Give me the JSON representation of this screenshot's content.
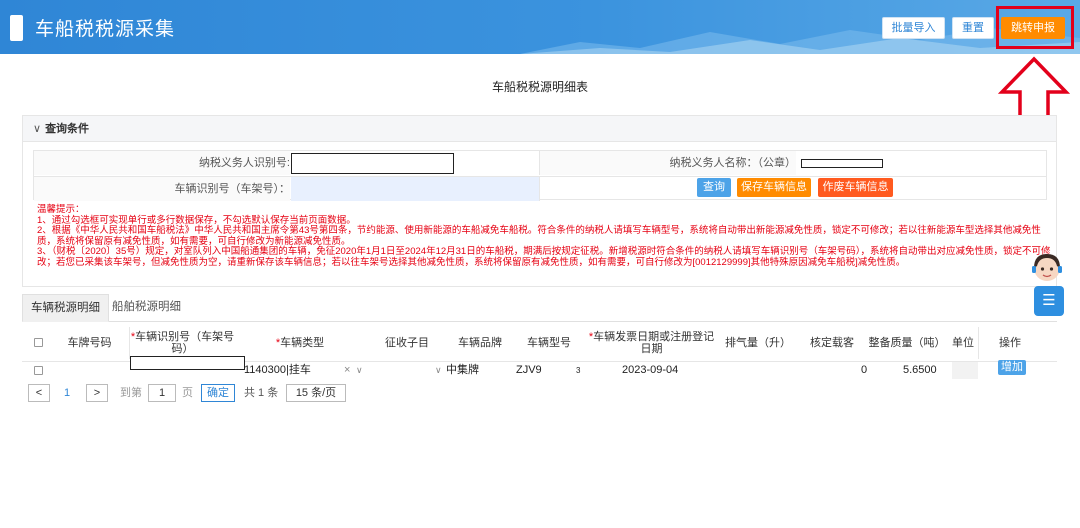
{
  "header": {
    "title": "车船税税源采集",
    "buttons": {
      "import": "批量导入",
      "reset": "重置",
      "jump": "跳转申报"
    }
  },
  "table_title": "车船税税源明细表",
  "query": {
    "heading": "查询条件",
    "taxpayer_id_label": "纳税义务人识别号:",
    "taxpayer_id_value": "",
    "taxpayer_name_label": "纳税义务人名称：（公章）",
    "taxpayer_name_value": "",
    "vehicle_id_label": "车辆识别号（车架号）：",
    "vehicle_id_value": "",
    "buttons": {
      "search": "查询",
      "save": "保存车辆信息",
      "void": "作废车辆信息"
    }
  },
  "tips": {
    "title": "温馨提示：",
    "line1": "1、通过勾选框可实现单行或多行数据保存，不勾选默认保存当前页面数据。",
    "line2": "2、根据《中华人民共和国车船税法》中华人民共和国主席令第43号第四条，节约能源、使用新能源的车船减免车船税。符合条件的纳税人请填写车辆型号，系统将自动带出新能源减免性质，锁定不可修改；若以往新能源车型选择其他减免性质，系统将保留原有减免性质，如有需要，可自行修改为新能源减免性质。",
    "line3": "3、（财税〔2020〕35号）规定，对室队列入中国船通集团的车辆，免征2020年1月1日至2024年12月31日的车船税，期满后按规定征税。新增税源时符合条件的纳税人请填写车辆识别号（车架号码），系统将自动带出对应减免性质，锁定不可修改；若您已采集该车架号，但减免性质为空，请重新保存该车辆信息；若以往车架号选择其他减免性质，系统将保留原有减免性质，如有需要，可自行修改为[0012129999]其他特殊原因减免车船税]减免性质。"
  },
  "tabs": [
    {
      "label": "车辆税源明细"
    },
    {
      "label": "船舶税源明细"
    }
  ],
  "table": {
    "headers": {
      "plate": "车牌号码",
      "vin": "车辆识别号（车架号码）",
      "vehicle_type": "车辆类型",
      "tax_item": "征收子目",
      "brand": "车辆品牌",
      "model": "车辆型号",
      "reg_date": "车辆发票日期或注册登记日期",
      "displacement": "排气量（升）",
      "passengers": "核定载客",
      "curb_weight": "整备质量（吨）",
      "unit": "单位",
      "action": "操作"
    },
    "row": {
      "plate": "",
      "vin": "",
      "vehicle_type": "1140300|挂车",
      "type_clear": "×",
      "type_arrow": "∨",
      "tax_item_arrow": "∨",
      "brand": "中集牌",
      "model": "ZJV9",
      "model_tail": "3",
      "reg_date": "2023-09-04",
      "passengers": "0",
      "curb_weight": "5.6500",
      "action": "增加"
    }
  },
  "pager": {
    "prev": "<",
    "current": "1",
    "next": ">",
    "goto_label": "到第",
    "goto_value": "1",
    "page_label": "页",
    "confirm": "确定",
    "total": "共 1 条",
    "page_size": "15 条/页"
  },
  "side": {
    "button_icon": "☰"
  },
  "colors": {
    "header_blue": "#2f86d6",
    "orange": "#ff8b00",
    "alert_red": "#e60012",
    "blue_button": "#4da3e8"
  }
}
